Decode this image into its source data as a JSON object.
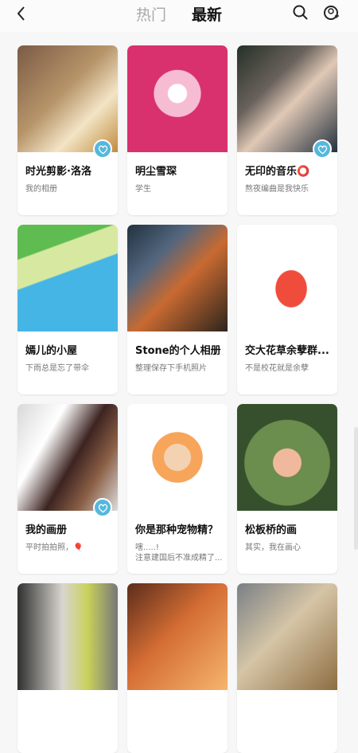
{
  "header": {
    "back_icon": "chevron-left-icon",
    "tabs": [
      "热门",
      "最新"
    ],
    "active_tab": 1,
    "search_icon": "search-icon",
    "upload_icon": "upload-icon"
  },
  "albums": [
    {
      "title": "时光剪影·洛洛",
      "subtitle": "我的相册",
      "heart": true
    },
    {
      "title": "明尘雪琛",
      "subtitle": "学生",
      "heart": false
    },
    {
      "title": "无印的音乐⭕",
      "subtitle": "熬夜编曲是我快乐",
      "heart": true
    },
    {
      "title": "嫣儿的小屋",
      "subtitle": "下雨总是忘了带伞",
      "heart": false
    },
    {
      "title": "Stone的个人相册",
      "subtitle": "整理保存下手机照片",
      "heart": false
    },
    {
      "title": "交大花草余孽群...",
      "subtitle": "不是校花就是余孽",
      "heart": false
    },
    {
      "title": "我的画册",
      "subtitle": "平时拍拍照，🎈",
      "heart": true
    },
    {
      "title": "你是那种宠物精？",
      "subtitle": "嗐.....!\n注意建国后不准成精了...",
      "heart": false
    },
    {
      "title": "松板桥的画",
      "subtitle": "其实，我在画心",
      "heart": false
    },
    {
      "title": "",
      "subtitle": "",
      "heart": false
    },
    {
      "title": "",
      "subtitle": "",
      "heart": false
    },
    {
      "title": "",
      "subtitle": "",
      "heart": false
    }
  ],
  "theme": {
    "accent": "#56b7dc",
    "text": "#111111",
    "muted": "#777777"
  }
}
